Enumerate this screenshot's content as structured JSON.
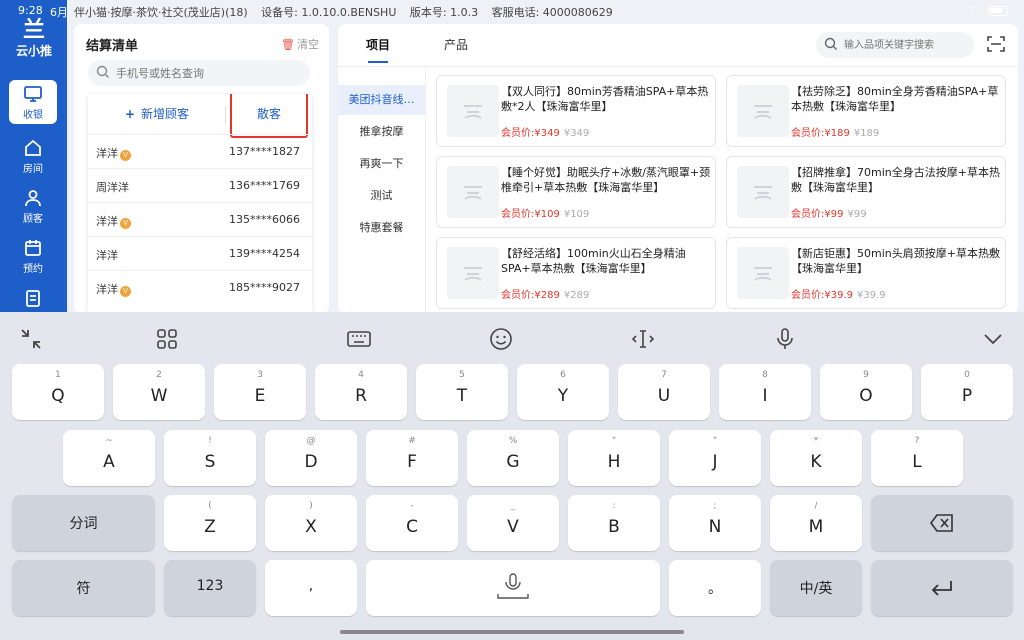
{
  "status": {
    "time": "9:28",
    "date": "6月"
  },
  "brand": {
    "mark": "兰",
    "name": "云小推"
  },
  "header": {
    "store": "伴小猫·按摩·茶饮·社交(茂业店)(18)",
    "device": "设备号: 1.0.10.0.BENSHU",
    "version": "版本号: 1.0.3",
    "hotline": "客服电话: 4000080629"
  },
  "sidebar": {
    "items": [
      {
        "label": "收银",
        "icon": "monitor-icon"
      },
      {
        "label": "房间",
        "icon": "home-icon"
      },
      {
        "label": "顾客",
        "icon": "user-icon"
      },
      {
        "label": "预约",
        "icon": "calendar-icon"
      },
      {
        "label": "",
        "icon": "clipboard-icon"
      }
    ]
  },
  "checkout": {
    "title": "结算清单",
    "clear_label": "清空",
    "search_placeholder": "手机号或姓名查询",
    "add_customer_label": "新增顾客",
    "walkin_label": "散客",
    "customers": [
      {
        "name": "洋洋",
        "vip": true,
        "phone": "137****1827"
      },
      {
        "name": "周洋洋",
        "vip": false,
        "phone": "136****1769"
      },
      {
        "name": "洋洋",
        "vip": true,
        "phone": "135****6066"
      },
      {
        "name": "洋洋",
        "vip": false,
        "phone": "139****4254"
      },
      {
        "name": "洋洋",
        "vip": true,
        "phone": "185****9027"
      }
    ]
  },
  "products": {
    "tabs": [
      "项目",
      "产品"
    ],
    "search_placeholder": "输入品项关键字搜索",
    "categories": [
      "美团抖音线…",
      "推拿按摩",
      "再爽一下",
      "测试",
      "特惠套餐"
    ],
    "member_label": "会员价:",
    "items": [
      {
        "name": "【双人同行】80min芳香精油SPA+草本热敷*2人【珠海富华里】",
        "member_price": "¥349",
        "price": "¥349"
      },
      {
        "name": "【祛劳除乏】80min全身芳香精油SPA+草本热敷【珠海富华里】",
        "member_price": "¥189",
        "price": "¥189"
      },
      {
        "name": "【睡个好觉】助眠头疗+冰敷/蒸汽眼罩+颈椎牵引+草本热敷【珠海富华里】",
        "member_price": "¥109",
        "price": "¥109"
      },
      {
        "name": "【招牌推拿】70min全身古法按摩+草本热敷【珠海富华里】",
        "member_price": "¥99",
        "price": "¥99"
      },
      {
        "name": "【舒经活络】100min火山石全身精油SPA+草本热敷【珠海富华里】",
        "member_price": "¥289",
        "price": "¥289"
      },
      {
        "name": "【新店钜惠】50min头肩颈按摩+草本热敷【珠海富华里】",
        "member_price": "¥39.9",
        "price": "¥39.9"
      }
    ]
  },
  "keyboard": {
    "row1": [
      {
        "hint": "1",
        "label": "Q"
      },
      {
        "hint": "2",
        "label": "W"
      },
      {
        "hint": "3",
        "label": "E"
      },
      {
        "hint": "4",
        "label": "R"
      },
      {
        "hint": "5",
        "label": "T"
      },
      {
        "hint": "6",
        "label": "Y"
      },
      {
        "hint": "7",
        "label": "U"
      },
      {
        "hint": "8",
        "label": "I"
      },
      {
        "hint": "9",
        "label": "O"
      },
      {
        "hint": "0",
        "label": "P"
      }
    ],
    "row2": [
      {
        "hint": "~",
        "label": "A"
      },
      {
        "hint": "!",
        "label": "S"
      },
      {
        "hint": "@",
        "label": "D"
      },
      {
        "hint": "#",
        "label": "F"
      },
      {
        "hint": "%",
        "label": "G"
      },
      {
        "hint": "\"",
        "label": "H"
      },
      {
        "hint": "\"",
        "label": "J"
      },
      {
        "hint": "*",
        "label": "K"
      },
      {
        "hint": "?",
        "label": "L"
      }
    ],
    "row3": [
      {
        "hint": "(",
        "label": "Z"
      },
      {
        "hint": ")",
        "label": "X"
      },
      {
        "hint": "-",
        "label": "C"
      },
      {
        "hint": "_",
        "label": "V"
      },
      {
        "hint": ":",
        "label": "B"
      },
      {
        "hint": ";",
        "label": "N"
      },
      {
        "hint": "/",
        "label": "M"
      }
    ],
    "segment_label": "分词",
    "symbol_label": "符",
    "number_label": "123",
    "comma_label": ",",
    "period_label": "。",
    "lang_label": "中/英"
  }
}
